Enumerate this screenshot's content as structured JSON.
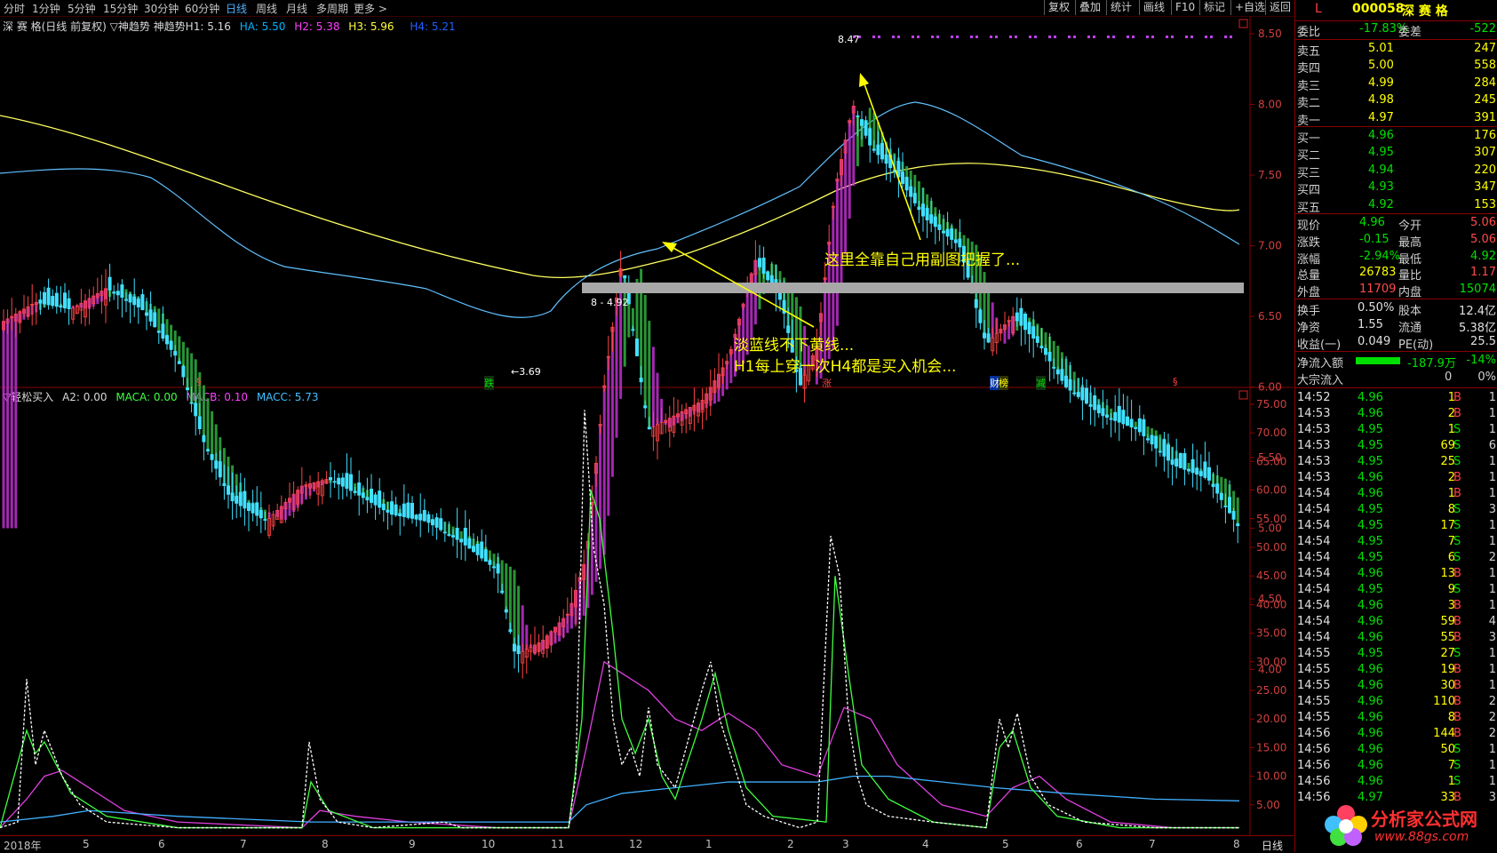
{
  "tabs": [
    "分时",
    "1分钟",
    "5分钟",
    "15分钟",
    "30分钟",
    "60分钟",
    "日线",
    "周线",
    "月线",
    "多周期",
    "更多 >"
  ],
  "active_tab": "日线",
  "toolbar": [
    "复权",
    "叠加",
    "统计",
    "画线",
    "F10",
    "标记",
    "+自选",
    "返回"
  ],
  "main_info": {
    "title": "深 赛 格(日线 前复权)",
    "indicator": "▽神趋势 神趋势H1:",
    "h1": "5.16",
    "ha_label": "HA:",
    "ha": "5.50",
    "h2_label": "H2:",
    "h2": "5.38",
    "h3_label": "H3:",
    "h3": "5.96",
    "h4_label": "H4:",
    "h4": "5.21"
  },
  "sub_info": {
    "indicator": "▽轻松买入",
    "a2": "A2: 0.00",
    "maca": "MACA: 0.00",
    "macb": "MACB: 0.10",
    "macc": "MACC: 5.73"
  },
  "price_axis": [
    "8.50",
    "8.00",
    "7.50",
    "7.00",
    "6.50",
    "6.00",
    "5.50",
    "5.00",
    "4.50",
    "4.00"
  ],
  "sub_axis": [
    "75.00",
    "70.00",
    "65.00",
    "60.00",
    "55.00",
    "50.00",
    "45.00",
    "40.00",
    "35.00",
    "30.00",
    "25.00",
    "20.00",
    "15.00",
    "10.00",
    "5.00"
  ],
  "price_labels": {
    "high": "8.47",
    "low": "←3.69",
    "mark": "8 - 4.92"
  },
  "annotations": {
    "right_note": "这里全靠自己用副图把握了...",
    "left_note_1": "淡蓝线不下黄线...",
    "left_note_2": "H1每上穿一次H4都是买入机会..."
  },
  "bottom_marks": [
    {
      "text": "§",
      "color": "#ff4040"
    },
    {
      "text": "跌",
      "color": "#00e000"
    },
    {
      "text": "涨",
      "color": "#ff4040"
    },
    {
      "text": "财",
      "color": "#ffffff"
    },
    {
      "text": "榜",
      "color": "#ffff00"
    },
    {
      "text": "减",
      "color": "#00e000"
    },
    {
      "text": "§",
      "color": "#ff4040"
    }
  ],
  "x_months": [
    "2018年",
    "5",
    "6",
    "7",
    "8",
    "9",
    "10",
    "11",
    "12",
    "1",
    "2",
    "3",
    "4",
    "5",
    "6",
    "7",
    "8"
  ],
  "period_label": "日线",
  "stock": {
    "code": "000058",
    "name": "深 赛 格",
    "flag": "L"
  },
  "quote_top": {
    "weibi_label": "委比",
    "weibi": "-17.83%",
    "weicha_label": "委差",
    "weicha": "-522"
  },
  "asks": [
    {
      "label": "卖五",
      "price": "5.01",
      "vol": "247"
    },
    {
      "label": "卖四",
      "price": "5.00",
      "vol": "558"
    },
    {
      "label": "卖三",
      "price": "4.99",
      "vol": "284"
    },
    {
      "label": "卖二",
      "price": "4.98",
      "vol": "245"
    },
    {
      "label": "卖一",
      "price": "4.97",
      "vol": "391"
    }
  ],
  "bids": [
    {
      "label": "买一",
      "price": "4.96",
      "vol": "176"
    },
    {
      "label": "买二",
      "price": "4.95",
      "vol": "307"
    },
    {
      "label": "买三",
      "price": "4.94",
      "vol": "220"
    },
    {
      "label": "买四",
      "price": "4.93",
      "vol": "347"
    },
    {
      "label": "买五",
      "price": "4.92",
      "vol": "153"
    }
  ],
  "stats": [
    {
      "l1": "现价",
      "v1": "4.96",
      "c1": "#00e000",
      "l2": "今开",
      "v2": "5.06",
      "c2": "#ff4b4b"
    },
    {
      "l1": "涨跌",
      "v1": "-0.15",
      "c1": "#00e000",
      "l2": "最高",
      "v2": "5.06",
      "c2": "#ff4b4b"
    },
    {
      "l1": "涨幅",
      "v1": "-2.94%",
      "c1": "#00e000",
      "l2": "最低",
      "v2": "4.92",
      "c2": "#00e000"
    },
    {
      "l1": "总量",
      "v1": "26783",
      "c1": "#ffff00",
      "l2": "量比",
      "v2": "1.17",
      "c2": "#ff4b4b"
    },
    {
      "l1": "外盘",
      "v1": "11709",
      "c1": "#ff4b4b",
      "l2": "内盘",
      "v2": "15074",
      "c2": "#00e000"
    }
  ],
  "stats2": [
    {
      "l1": "换手",
      "v1": "0.50%",
      "l2": "股本",
      "v2": "12.4亿"
    },
    {
      "l1": "净资",
      "v1": "1.55",
      "l2": "流通",
      "v2": "5.38亿"
    },
    {
      "l1": "收益(一)",
      "v1": "0.049",
      "l2": "PE(动)",
      "v2": "25.5"
    }
  ],
  "flow": {
    "label": "净流入额",
    "value": "-187.9万",
    "pct": "-14%",
    "label2": "大宗流入",
    "v2": "0",
    "pct2": "0%"
  },
  "ticks": [
    {
      "t": "14:52",
      "p": "4.96",
      "v": "1",
      "d": "B",
      "n": "1"
    },
    {
      "t": "14:53",
      "p": "4.96",
      "v": "2",
      "d": "B",
      "n": "1"
    },
    {
      "t": "14:53",
      "p": "4.95",
      "v": "1",
      "d": "S",
      "n": "1"
    },
    {
      "t": "14:53",
      "p": "4.95",
      "v": "69",
      "d": "S",
      "n": "6"
    },
    {
      "t": "14:53",
      "p": "4.95",
      "v": "25",
      "d": "S",
      "n": "1"
    },
    {
      "t": "14:53",
      "p": "4.96",
      "v": "2",
      "d": "B",
      "n": "1"
    },
    {
      "t": "14:54",
      "p": "4.96",
      "v": "1",
      "d": "B",
      "n": "1"
    },
    {
      "t": "14:54",
      "p": "4.95",
      "v": "8",
      "d": "S",
      "n": "3"
    },
    {
      "t": "14:54",
      "p": "4.95",
      "v": "17",
      "d": "S",
      "n": "1"
    },
    {
      "t": "14:54",
      "p": "4.95",
      "v": "7",
      "d": "S",
      "n": "1"
    },
    {
      "t": "14:54",
      "p": "4.95",
      "v": "6",
      "d": "S",
      "n": "2"
    },
    {
      "t": "14:54",
      "p": "4.96",
      "v": "13",
      "d": "B",
      "n": "1"
    },
    {
      "t": "14:54",
      "p": "4.95",
      "v": "9",
      "d": "S",
      "n": "1"
    },
    {
      "t": "14:54",
      "p": "4.96",
      "v": "3",
      "d": "B",
      "n": "1"
    },
    {
      "t": "14:54",
      "p": "4.96",
      "v": "59",
      "d": "B",
      "n": "4"
    },
    {
      "t": "14:54",
      "p": "4.96",
      "v": "55",
      "d": "B",
      "n": "3"
    },
    {
      "t": "14:55",
      "p": "4.95",
      "v": "27",
      "d": "S",
      "n": "1"
    },
    {
      "t": "14:55",
      "p": "4.96",
      "v": "19",
      "d": "B",
      "n": "1"
    },
    {
      "t": "14:55",
      "p": "4.96",
      "v": "30",
      "d": "B",
      "n": "1"
    },
    {
      "t": "14:55",
      "p": "4.96",
      "v": "110",
      "d": "B",
      "n": "2"
    },
    {
      "t": "14:55",
      "p": "4.96",
      "v": "8",
      "d": "B",
      "n": "2"
    },
    {
      "t": "14:56",
      "p": "4.96",
      "v": "144",
      "d": "B",
      "n": "2"
    },
    {
      "t": "14:56",
      "p": "4.96",
      "v": "50",
      "d": "S",
      "n": "1"
    },
    {
      "t": "14:56",
      "p": "4.96",
      "v": "7",
      "d": "S",
      "n": "1"
    },
    {
      "t": "14:56",
      "p": "4.96",
      "v": "1",
      "d": "S",
      "n": "1"
    },
    {
      "t": "14:56",
      "p": "4.97",
      "v": "33",
      "d": "B",
      "n": "3"
    }
  ],
  "watermark": {
    "name": "分析家公式网",
    "url": "www.88gs.com"
  }
}
